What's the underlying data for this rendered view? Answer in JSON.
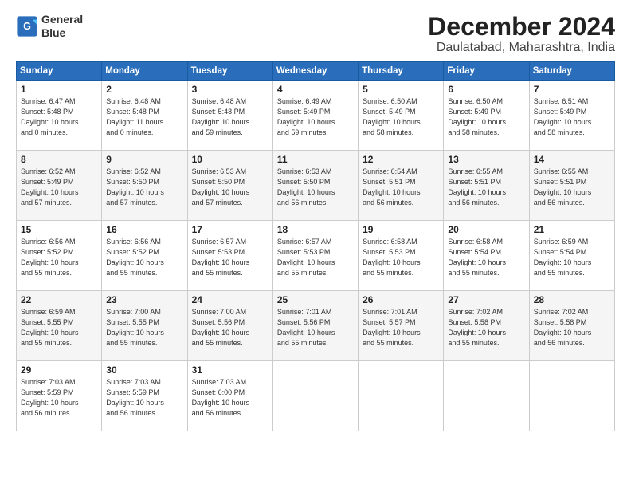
{
  "header": {
    "logo_line1": "General",
    "logo_line2": "Blue",
    "month": "December 2024",
    "location": "Daulatabad, Maharashtra, India"
  },
  "columns": [
    "Sunday",
    "Monday",
    "Tuesday",
    "Wednesday",
    "Thursday",
    "Friday",
    "Saturday"
  ],
  "weeks": [
    [
      {
        "day": "1",
        "lines": [
          "Sunrise: 6:47 AM",
          "Sunset: 5:48 PM",
          "Daylight: 10 hours",
          "and 0 minutes."
        ]
      },
      {
        "day": "2",
        "lines": [
          "Sunrise: 6:48 AM",
          "Sunset: 5:48 PM",
          "Daylight: 11 hours",
          "and 0 minutes."
        ]
      },
      {
        "day": "3",
        "lines": [
          "Sunrise: 6:48 AM",
          "Sunset: 5:48 PM",
          "Daylight: 10 hours",
          "and 59 minutes."
        ]
      },
      {
        "day": "4",
        "lines": [
          "Sunrise: 6:49 AM",
          "Sunset: 5:49 PM",
          "Daylight: 10 hours",
          "and 59 minutes."
        ]
      },
      {
        "day": "5",
        "lines": [
          "Sunrise: 6:50 AM",
          "Sunset: 5:49 PM",
          "Daylight: 10 hours",
          "and 58 minutes."
        ]
      },
      {
        "day": "6",
        "lines": [
          "Sunrise: 6:50 AM",
          "Sunset: 5:49 PM",
          "Daylight: 10 hours",
          "and 58 minutes."
        ]
      },
      {
        "day": "7",
        "lines": [
          "Sunrise: 6:51 AM",
          "Sunset: 5:49 PM",
          "Daylight: 10 hours",
          "and 58 minutes."
        ]
      }
    ],
    [
      {
        "day": "8",
        "lines": [
          "Sunrise: 6:52 AM",
          "Sunset: 5:49 PM",
          "Daylight: 10 hours",
          "and 57 minutes."
        ]
      },
      {
        "day": "9",
        "lines": [
          "Sunrise: 6:52 AM",
          "Sunset: 5:50 PM",
          "Daylight: 10 hours",
          "and 57 minutes."
        ]
      },
      {
        "day": "10",
        "lines": [
          "Sunrise: 6:53 AM",
          "Sunset: 5:50 PM",
          "Daylight: 10 hours",
          "and 57 minutes."
        ]
      },
      {
        "day": "11",
        "lines": [
          "Sunrise: 6:53 AM",
          "Sunset: 5:50 PM",
          "Daylight: 10 hours",
          "and 56 minutes."
        ]
      },
      {
        "day": "12",
        "lines": [
          "Sunrise: 6:54 AM",
          "Sunset: 5:51 PM",
          "Daylight: 10 hours",
          "and 56 minutes."
        ]
      },
      {
        "day": "13",
        "lines": [
          "Sunrise: 6:55 AM",
          "Sunset: 5:51 PM",
          "Daylight: 10 hours",
          "and 56 minutes."
        ]
      },
      {
        "day": "14",
        "lines": [
          "Sunrise: 6:55 AM",
          "Sunset: 5:51 PM",
          "Daylight: 10 hours",
          "and 56 minutes."
        ]
      }
    ],
    [
      {
        "day": "15",
        "lines": [
          "Sunrise: 6:56 AM",
          "Sunset: 5:52 PM",
          "Daylight: 10 hours",
          "and 55 minutes."
        ]
      },
      {
        "day": "16",
        "lines": [
          "Sunrise: 6:56 AM",
          "Sunset: 5:52 PM",
          "Daylight: 10 hours",
          "and 55 minutes."
        ]
      },
      {
        "day": "17",
        "lines": [
          "Sunrise: 6:57 AM",
          "Sunset: 5:53 PM",
          "Daylight: 10 hours",
          "and 55 minutes."
        ]
      },
      {
        "day": "18",
        "lines": [
          "Sunrise: 6:57 AM",
          "Sunset: 5:53 PM",
          "Daylight: 10 hours",
          "and 55 minutes."
        ]
      },
      {
        "day": "19",
        "lines": [
          "Sunrise: 6:58 AM",
          "Sunset: 5:53 PM",
          "Daylight: 10 hours",
          "and 55 minutes."
        ]
      },
      {
        "day": "20",
        "lines": [
          "Sunrise: 6:58 AM",
          "Sunset: 5:54 PM",
          "Daylight: 10 hours",
          "and 55 minutes."
        ]
      },
      {
        "day": "21",
        "lines": [
          "Sunrise: 6:59 AM",
          "Sunset: 5:54 PM",
          "Daylight: 10 hours",
          "and 55 minutes."
        ]
      }
    ],
    [
      {
        "day": "22",
        "lines": [
          "Sunrise: 6:59 AM",
          "Sunset: 5:55 PM",
          "Daylight: 10 hours",
          "and 55 minutes."
        ]
      },
      {
        "day": "23",
        "lines": [
          "Sunrise: 7:00 AM",
          "Sunset: 5:55 PM",
          "Daylight: 10 hours",
          "and 55 minutes."
        ]
      },
      {
        "day": "24",
        "lines": [
          "Sunrise: 7:00 AM",
          "Sunset: 5:56 PM",
          "Daylight: 10 hours",
          "and 55 minutes."
        ]
      },
      {
        "day": "25",
        "lines": [
          "Sunrise: 7:01 AM",
          "Sunset: 5:56 PM",
          "Daylight: 10 hours",
          "and 55 minutes."
        ]
      },
      {
        "day": "26",
        "lines": [
          "Sunrise: 7:01 AM",
          "Sunset: 5:57 PM",
          "Daylight: 10 hours",
          "and 55 minutes."
        ]
      },
      {
        "day": "27",
        "lines": [
          "Sunrise: 7:02 AM",
          "Sunset: 5:58 PM",
          "Daylight: 10 hours",
          "and 55 minutes."
        ]
      },
      {
        "day": "28",
        "lines": [
          "Sunrise: 7:02 AM",
          "Sunset: 5:58 PM",
          "Daylight: 10 hours",
          "and 56 minutes."
        ]
      }
    ],
    [
      {
        "day": "29",
        "lines": [
          "Sunrise: 7:03 AM",
          "Sunset: 5:59 PM",
          "Daylight: 10 hours",
          "and 56 minutes."
        ]
      },
      {
        "day": "30",
        "lines": [
          "Sunrise: 7:03 AM",
          "Sunset: 5:59 PM",
          "Daylight: 10 hours",
          "and 56 minutes."
        ]
      },
      {
        "day": "31",
        "lines": [
          "Sunrise: 7:03 AM",
          "Sunset: 6:00 PM",
          "Daylight: 10 hours",
          "and 56 minutes."
        ]
      },
      null,
      null,
      null,
      null
    ]
  ]
}
